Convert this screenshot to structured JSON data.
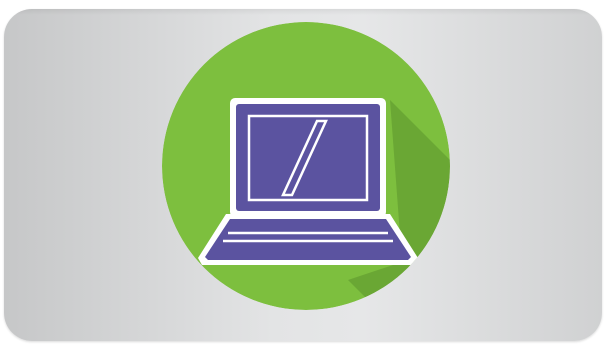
{
  "icon": {
    "name": "laptop-icon",
    "circle_color": "#7dbf3e",
    "device_color": "#5b53a0",
    "outline_color": "#ffffff",
    "card_color": "#dcdddd"
  }
}
